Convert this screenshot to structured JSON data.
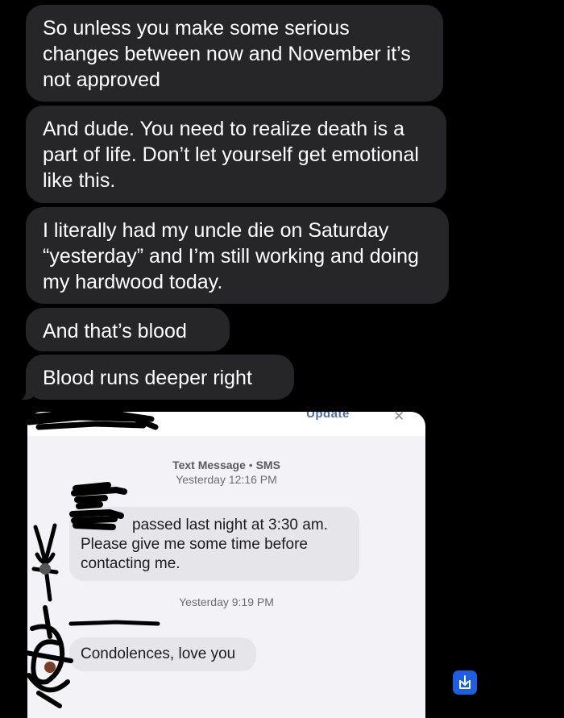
{
  "messages": [
    {
      "text": "So unless you make some serious changes between now and November it’s not approved"
    },
    {
      "text": "And dude. You need to realize death is a part of life. Don’t let yourself get emotional like this."
    },
    {
      "text": "I literally had my uncle die on Saturday “yesterday” and I’m still working and doing my hardwood today."
    },
    {
      "text": "And that’s blood"
    },
    {
      "text": "Blood runs deeper right"
    }
  ],
  "embedded": {
    "update_label": "Update",
    "close_glyph": "✕",
    "first_meta": {
      "kind": "Text Message",
      "service": "SMS",
      "separator": "•",
      "time": "Yesterday 12:16 PM"
    },
    "first_message": "passed last night at 3:30 am. Please give me some time before contacting me.",
    "second_meta": "Yesterday 9:19 PM",
    "second_message": "Condolences, love you"
  },
  "icons": {
    "share": "share-download-icon",
    "redaction": "scribble-redaction"
  },
  "colors": {
    "dark_bubble": "#262629",
    "light_bubble": "#e5e5ea",
    "share_button": "#1d5fe0"
  }
}
